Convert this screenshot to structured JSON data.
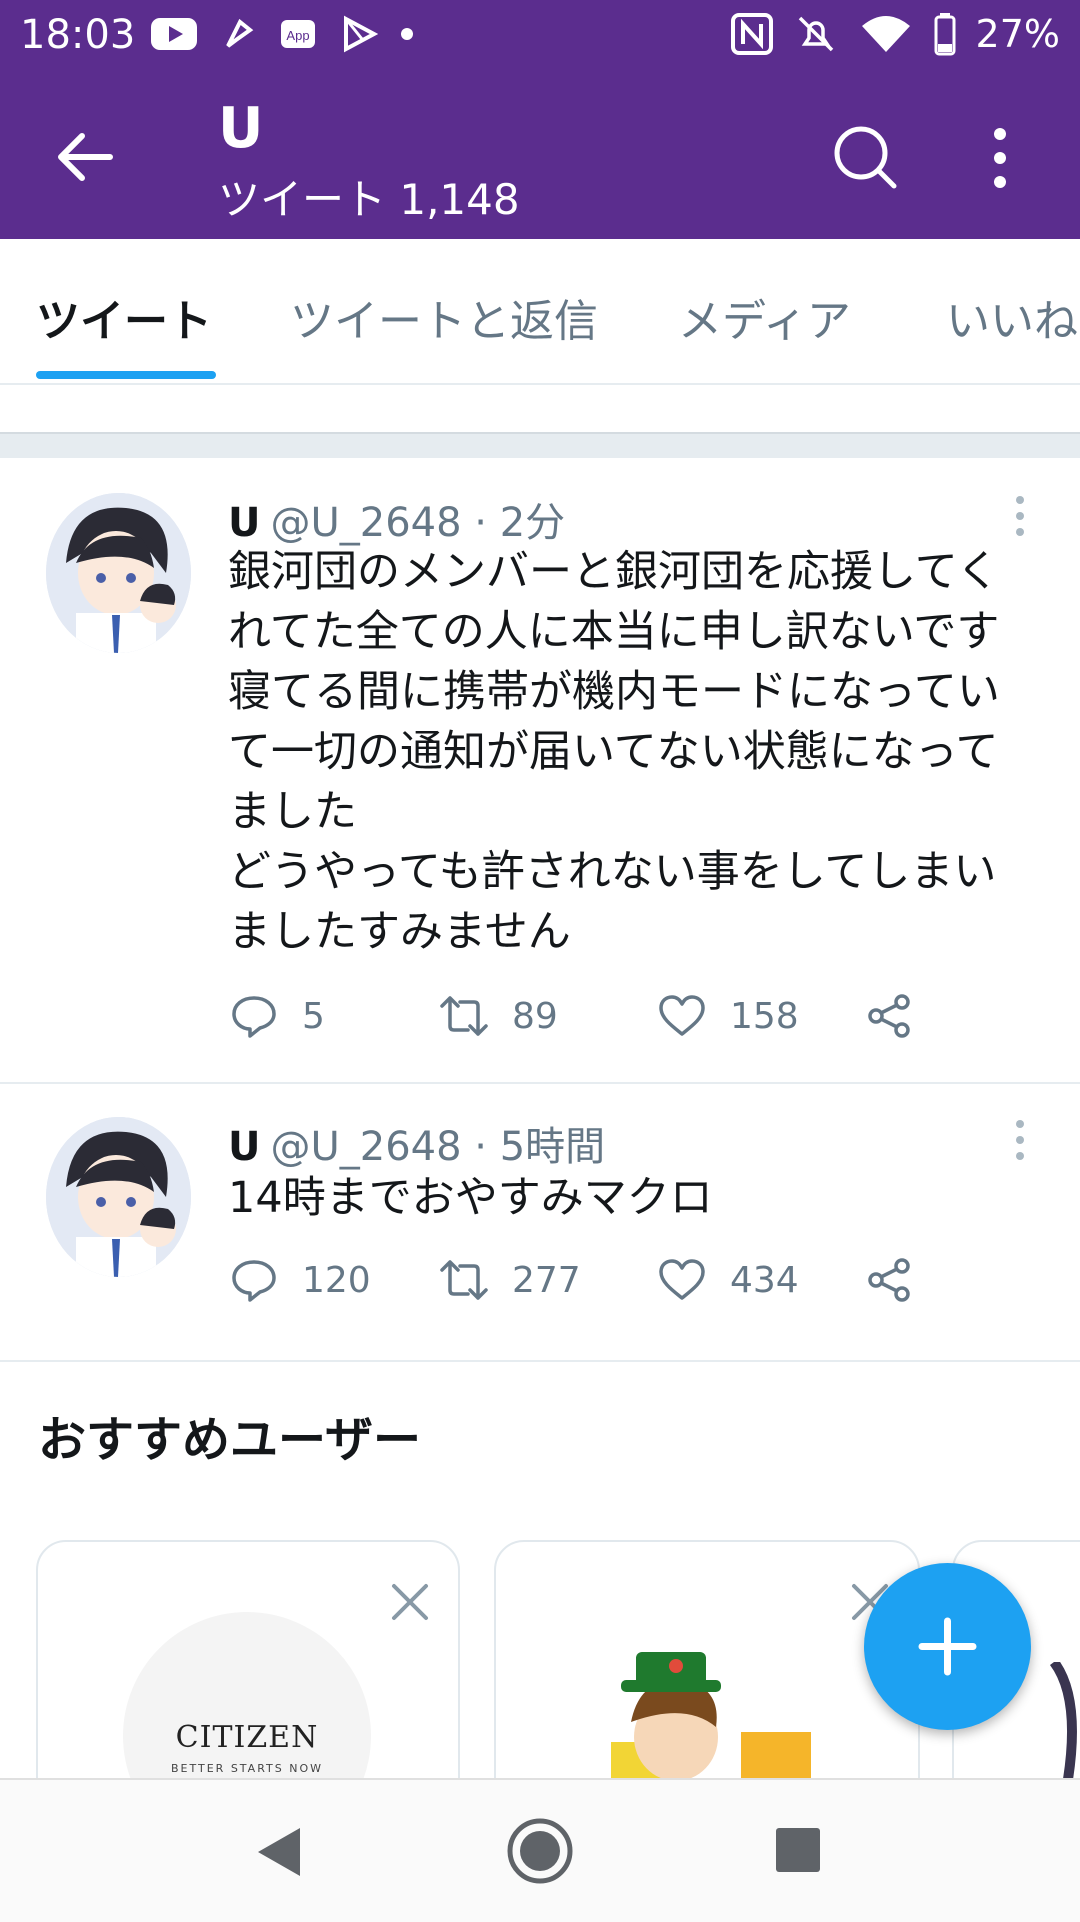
{
  "status_bar": {
    "time": "18:03",
    "battery": "27%"
  },
  "header": {
    "name": "U",
    "tweet_count_label": "ツイート 1,148"
  },
  "tabs": [
    {
      "label": "ツイート",
      "active": true
    },
    {
      "label": "ツイートと返信",
      "active": false
    },
    {
      "label": "メディア",
      "active": false
    },
    {
      "label": "いいね",
      "active": false
    }
  ],
  "tweets": [
    {
      "name": "U",
      "meta": "@U_2648 · 2分",
      "text": "銀河団のメンバーと銀河団を応援してく\nれてた全ての人に本当に申し訳ないです\n寝てる間に携帯が機内モードになってい\nて一切の通知が届いてない状態になって\nました\nどうやっても許されない事をしてしまい\nましたすみません",
      "replies": "5",
      "retweets": "89",
      "likes": "158"
    },
    {
      "name": "U",
      "meta": "@U_2648 · 5時間",
      "text": "14時までおやすみマクロ",
      "replies": "120",
      "retweets": "277",
      "likes": "434"
    }
  ],
  "recommended": {
    "title": "おすすめユーザー",
    "cards": [
      {
        "logo_text": "CITIZEN",
        "logo_sub": "BETTER STARTS NOW"
      }
    ]
  },
  "colors": {
    "header_bg": "#5b2d8e",
    "accent": "#1da1f2",
    "muted": "#657786"
  }
}
